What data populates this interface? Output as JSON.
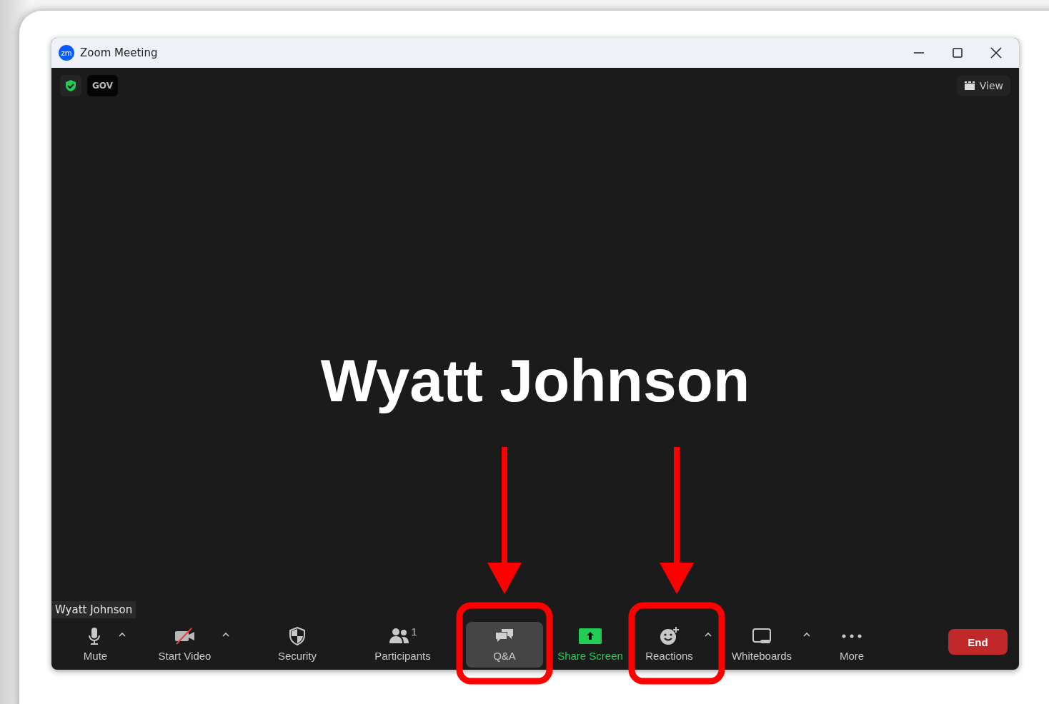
{
  "window": {
    "logo_text": "zm",
    "title": "Zoom Meeting"
  },
  "top_bar": {
    "badge": "GOV",
    "view_button": "View"
  },
  "participant": {
    "name": "Wyatt Johnson",
    "name_tag": "Wyatt Johnson"
  },
  "toolbar": [
    {
      "kind": "mic",
      "label": "Mute",
      "caret": true,
      "selected": false
    },
    {
      "kind": "video",
      "label": "Start Video",
      "caret": true,
      "selected": false
    },
    {
      "kind": "security",
      "label": "Security",
      "caret": false,
      "selected": false
    },
    {
      "kind": "participants",
      "label": "Participants",
      "count": "1",
      "caret": false,
      "selected": false
    },
    {
      "kind": "qa",
      "label": "Q&A",
      "caret": false,
      "selected": true,
      "highlighted": true
    },
    {
      "kind": "share",
      "label": "Share Screen",
      "caret": false,
      "selected": false
    },
    {
      "kind": "reactions",
      "label": "Reactions",
      "caret": true,
      "selected": false,
      "highlighted": true
    },
    {
      "kind": "whiteboards",
      "label": "Whiteboards",
      "caret": true,
      "selected": false
    },
    {
      "kind": "more",
      "label": "More",
      "caret": false,
      "selected": false
    }
  ],
  "end_button": "End"
}
